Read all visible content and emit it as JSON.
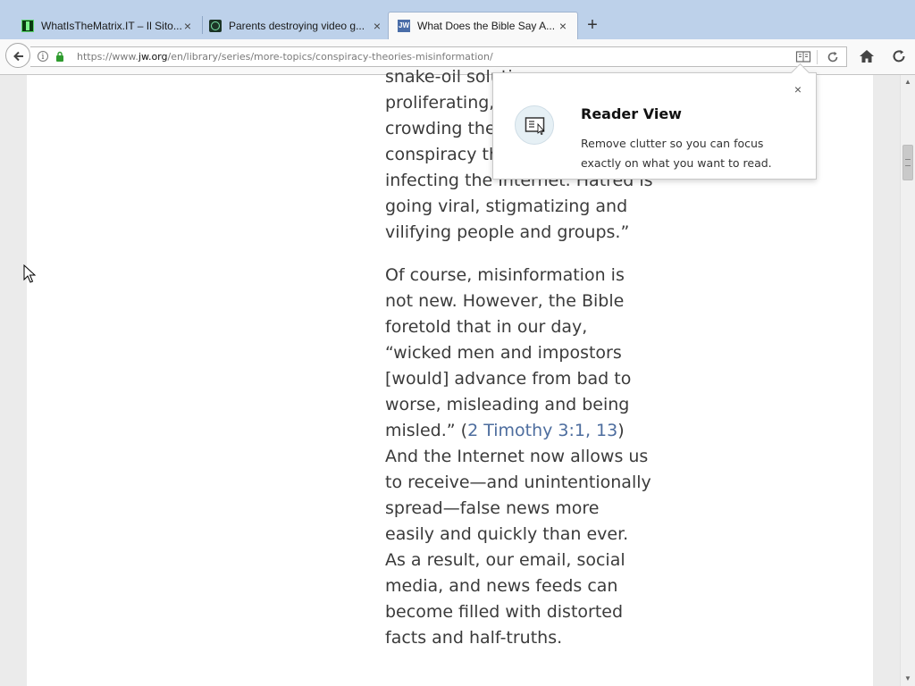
{
  "browser": {
    "tabs": [
      {
        "label": "WhatIsTheMatrix.IT – Il Sito...",
        "icon": "matrix-favicon",
        "active": false
      },
      {
        "label": "Parents destroying video g...",
        "icon": "site-favicon",
        "active": false
      },
      {
        "label": "What Does the Bible Say A...",
        "icon": "jw-favicon",
        "active": true
      }
    ],
    "new_tab_label": "+",
    "close_glyph": "×",
    "url": {
      "prefix": "https://www.",
      "domain": "jw.org",
      "path": "/en/library/series/more-topics/conspiracy-theories-misinformation/"
    }
  },
  "article": {
    "paragraph1": "snake-oil solutions are proliferating, “Falsehoods are crowding the airwaves. Wild conspiracy theories are infecting the Internet. Hatred is going viral, stigmatizing and vilifying people and groups.”",
    "paragraph2_before": "Of course, misinformation is not new. However, the Bible foretold that in our day, “wicked men and impostors [would] advance from bad to worse, misleading and being misled.” (",
    "scripture_ref": "2 Timothy 3:1, 13",
    "paragraph2_after": ") And the Internet now allows us to receive—and unintentionally spread—false news more easily and quickly than ever. As a result, our email, social media, and news feeds can become filled with distorted facts and half-truths."
  },
  "reader_popup": {
    "title": "Reader View",
    "description": "Remove clutter so you can focus exactly on what you want to read.",
    "close": "×"
  },
  "colors": {
    "tabstrip": "#bdd1ea",
    "link": "#4d6d9e",
    "text": "#3b3b3b"
  }
}
